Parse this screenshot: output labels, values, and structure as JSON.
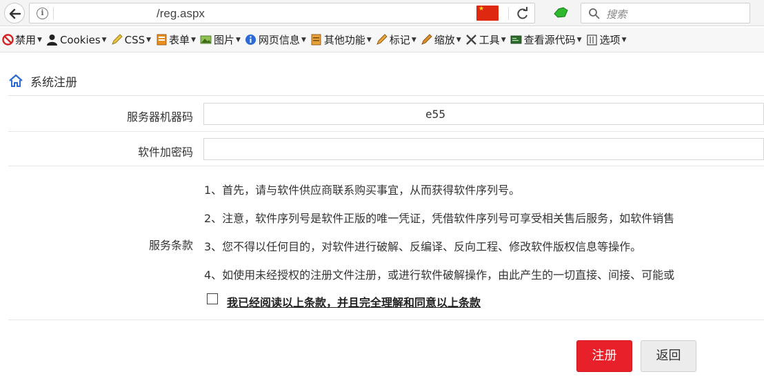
{
  "browser": {
    "url": "/reg.aspx",
    "search_placeholder": "搜索"
  },
  "toolbar": {
    "items": [
      {
        "label": "禁用",
        "icon": "disable-icon"
      },
      {
        "label": "Cookies",
        "icon": "user-icon"
      },
      {
        "label": "CSS",
        "icon": "pencil-icon"
      },
      {
        "label": "表单",
        "icon": "form-icon"
      },
      {
        "label": "图片",
        "icon": "image-icon"
      },
      {
        "label": "网页信息",
        "icon": "info-icon"
      },
      {
        "label": "其他功能",
        "icon": "misc-icon"
      },
      {
        "label": "标记",
        "icon": "marker-icon"
      },
      {
        "label": "缩放",
        "icon": "resize-icon"
      },
      {
        "label": "工具",
        "icon": "tools-icon"
      },
      {
        "label": "查看源代码",
        "icon": "source-icon"
      },
      {
        "label": "选项",
        "icon": "options-icon"
      }
    ]
  },
  "page": {
    "title": "系统注册"
  },
  "form": {
    "machine_code_label": "服务器机器码",
    "machine_code_value": "e55",
    "encrypt_code_label": "软件加密码",
    "encrypt_code_value": "",
    "terms_label": "服务条款",
    "terms": [
      "1、首先，请与软件供应商联系购买事宜，从而获得软件序列号。",
      "2、注意，软件序列号是软件正版的唯一凭证，凭借软件序列号可享受相关售后服务，如软件销售",
      "3、您不得以任何目的，对软件进行破解、反编译、反向工程、修改软件版权信息等操作。",
      "4、如使用未经授权的注册文件注册，或进行软件破解操作，由此产生的一切直接、间接、可能或"
    ],
    "agree_text": "我已经阅读以上条款，并且完全理解和同意以上条款",
    "agree_checked": false
  },
  "buttons": {
    "register": "注册",
    "back": "返回"
  },
  "colors": {
    "primary": "#e8202a",
    "secondary": "#ececec"
  }
}
